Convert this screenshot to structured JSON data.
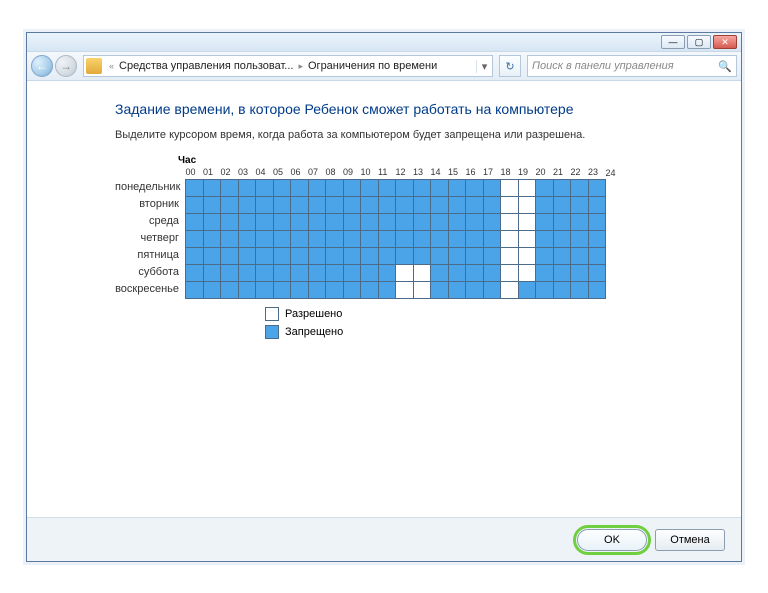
{
  "titlebar": {
    "min": "—",
    "max": "▢",
    "close": "✕"
  },
  "nav": {
    "back": "←",
    "fwd": "→",
    "refresh": "↻",
    "chevrons": "«",
    "crumb1": "Средства управления пользоват...",
    "crumb2": "Ограничения по времени",
    "dropdown": "▾",
    "search_placeholder": "Поиск в панели управления",
    "search_icon": "🔍"
  },
  "heading": "Задание времени, в которое Ребенок сможет работать на компьютере",
  "instruction": "Выделите курсором время, когда работа за компьютером будет запрещена или разрешена.",
  "hour_label": "Час",
  "hours": [
    "00",
    "01",
    "02",
    "03",
    "04",
    "05",
    "06",
    "07",
    "08",
    "09",
    "10",
    "11",
    "12",
    "13",
    "14",
    "15",
    "16",
    "17",
    "18",
    "19",
    "20",
    "21",
    "22",
    "23",
    "24"
  ],
  "days": [
    "понедельник",
    "вторник",
    "среда",
    "четверг",
    "пятница",
    "суббота",
    "воскресенье"
  ],
  "schedule": [
    [
      1,
      1,
      1,
      1,
      1,
      1,
      1,
      1,
      1,
      1,
      1,
      1,
      1,
      1,
      1,
      1,
      1,
      1,
      0,
      0,
      1,
      1,
      1,
      1
    ],
    [
      1,
      1,
      1,
      1,
      1,
      1,
      1,
      1,
      1,
      1,
      1,
      1,
      1,
      1,
      1,
      1,
      1,
      1,
      0,
      0,
      1,
      1,
      1,
      1
    ],
    [
      1,
      1,
      1,
      1,
      1,
      1,
      1,
      1,
      1,
      1,
      1,
      1,
      1,
      1,
      1,
      1,
      1,
      1,
      0,
      0,
      1,
      1,
      1,
      1
    ],
    [
      1,
      1,
      1,
      1,
      1,
      1,
      1,
      1,
      1,
      1,
      1,
      1,
      1,
      1,
      1,
      1,
      1,
      1,
      0,
      0,
      1,
      1,
      1,
      1
    ],
    [
      1,
      1,
      1,
      1,
      1,
      1,
      1,
      1,
      1,
      1,
      1,
      1,
      1,
      1,
      1,
      1,
      1,
      1,
      0,
      0,
      1,
      1,
      1,
      1
    ],
    [
      1,
      1,
      1,
      1,
      1,
      1,
      1,
      1,
      1,
      1,
      1,
      1,
      0,
      0,
      1,
      1,
      1,
      1,
      0,
      0,
      1,
      1,
      1,
      1
    ],
    [
      1,
      1,
      1,
      1,
      1,
      1,
      1,
      1,
      1,
      1,
      1,
      1,
      0,
      0,
      1,
      1,
      1,
      1,
      0,
      1,
      1,
      1,
      1,
      1
    ]
  ],
  "legend": {
    "allowed": "Разрешено",
    "blocked": "Запрещено"
  },
  "footer": {
    "ok": "OK",
    "cancel": "Отмена"
  },
  "colors": {
    "allowed": "#ffffff",
    "blocked": "#4ba3e8"
  }
}
